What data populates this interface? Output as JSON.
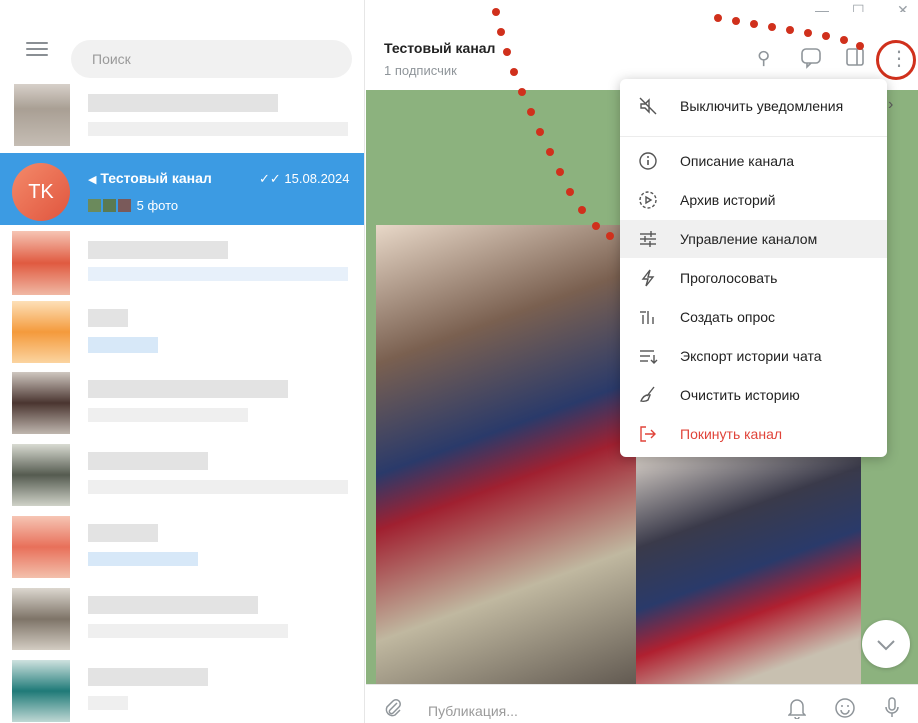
{
  "window": {
    "minimize": "—",
    "maximize": "☐",
    "close": "✕"
  },
  "sidebar": {
    "search_placeholder": "Поиск",
    "selected_chat": {
      "avatar_initials": "TK",
      "title": "Тестовый канал",
      "date": "15.08.2024",
      "preview": "5 фото"
    }
  },
  "header": {
    "title": "Тестовый канал",
    "subtitle": "1 подписчик"
  },
  "composer": {
    "placeholder": "Публикация..."
  },
  "menu": {
    "items": [
      {
        "label": "Выключить уведомления",
        "icon": "mute-icon"
      },
      {
        "label": "Описание канала",
        "icon": "info-icon"
      },
      {
        "label": "Архив историй",
        "icon": "story-archive-icon"
      },
      {
        "label": "Управление каналом",
        "icon": "manage-icon"
      },
      {
        "label": "Проголосовать",
        "icon": "boost-icon"
      },
      {
        "label": "Создать опрос",
        "icon": "poll-icon"
      },
      {
        "label": "Экспорт истории чата",
        "icon": "export-icon"
      },
      {
        "label": "Очистить историю",
        "icon": "clear-icon"
      },
      {
        "label": "Покинуть канал",
        "icon": "leave-icon"
      }
    ]
  },
  "colors": {
    "accent": "#3c9be3",
    "danger": "#e0443a",
    "annotation": "#d0301c"
  }
}
